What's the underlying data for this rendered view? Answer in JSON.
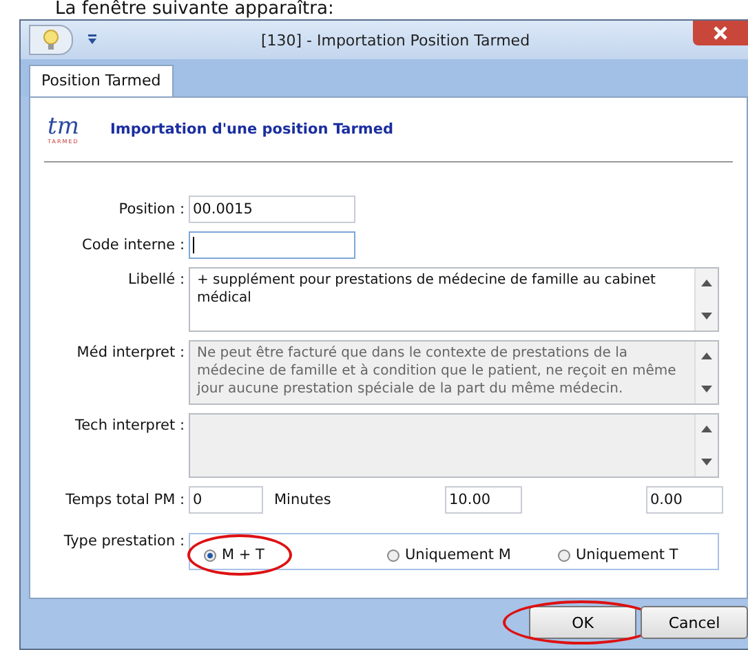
{
  "caption": "La fenêtre suivante apparaîtra:",
  "window": {
    "title": "[130] - Importation Position Tarmed"
  },
  "tabs": [
    {
      "label": "Position Tarmed",
      "selected": true
    }
  ],
  "header": {
    "logo": "tm",
    "logo_sub": "TARMED",
    "title": "Importation d'une position Tarmed"
  },
  "fields": [
    {
      "kind": "text",
      "label": "Position :",
      "value": "00.0015",
      "focused": false
    },
    {
      "kind": "text",
      "label": "Code interne :",
      "focused": true
    },
    {
      "kind": "memo",
      "label": "Libellé :",
      "value": "+ supplément pour prestations de médecine de famille au cabinet médical",
      "disabled": false
    },
    {
      "kind": "memo",
      "label": "Méd interpret :",
      "value": "Ne peut être facturé que dans le contexte de prestations de la médecine de famille et à condition que le patient, ne reçoit en même jour aucune prestation spéciale de la part du même médecin.",
      "disabled": true
    },
    {
      "kind": "memo",
      "label": "Tech interpret :",
      "disabled": true
    }
  ],
  "temps": {
    "label": "Temps total PM :",
    "value": "0",
    "unit": "Minutes",
    "values": [
      "10.00",
      "0.00"
    ]
  },
  "type_prestation": {
    "label": "Type prestation :",
    "options": [
      {
        "label": "M + T",
        "selected": true,
        "circled": true
      },
      {
        "label": "Uniquement M",
        "selected": false,
        "circled": false
      },
      {
        "label": "Uniquement T",
        "selected": false,
        "circled": false
      }
    ]
  },
  "buttons": [
    {
      "label": "OK",
      "circled": true
    },
    {
      "label": "Cancel",
      "circled": false
    }
  ]
}
